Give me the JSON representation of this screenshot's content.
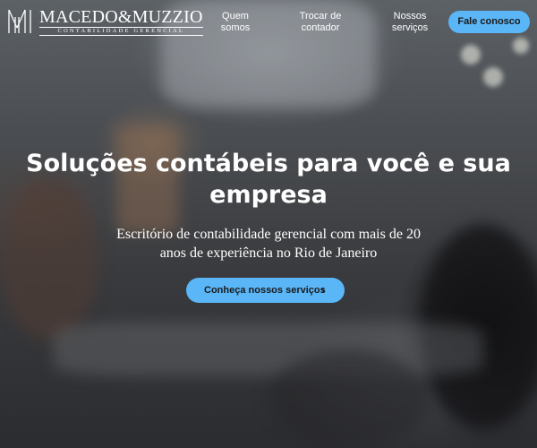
{
  "logo": {
    "name": "MACEDO&MUZZIO",
    "tagline": "CONTABILIDADE GERENCIAL",
    "mark_icon": "mm-monogram-icon"
  },
  "nav": {
    "items": [
      {
        "line1": "Quem",
        "line2": "somos"
      },
      {
        "line1": "Trocar de",
        "line2": "contador"
      },
      {
        "line1": "Nossos",
        "line2": "serviços"
      }
    ],
    "cta_label": "Fale conosco"
  },
  "hero": {
    "title_line1": "Soluções contábeis para você e sua",
    "title_line2": "empresa",
    "subtitle_line1": "Escritório de contabilidade gerencial com mais de 20",
    "subtitle_line2": "anos de experiência no Rio de Janeiro",
    "cta_label": "Conheça nossos serviços",
    "cta_icon": "chevron-right-icon"
  },
  "colors": {
    "accent": "#5ab6f7",
    "text_on_dark": "#ffffff",
    "button_text": "#1a1a1a"
  }
}
